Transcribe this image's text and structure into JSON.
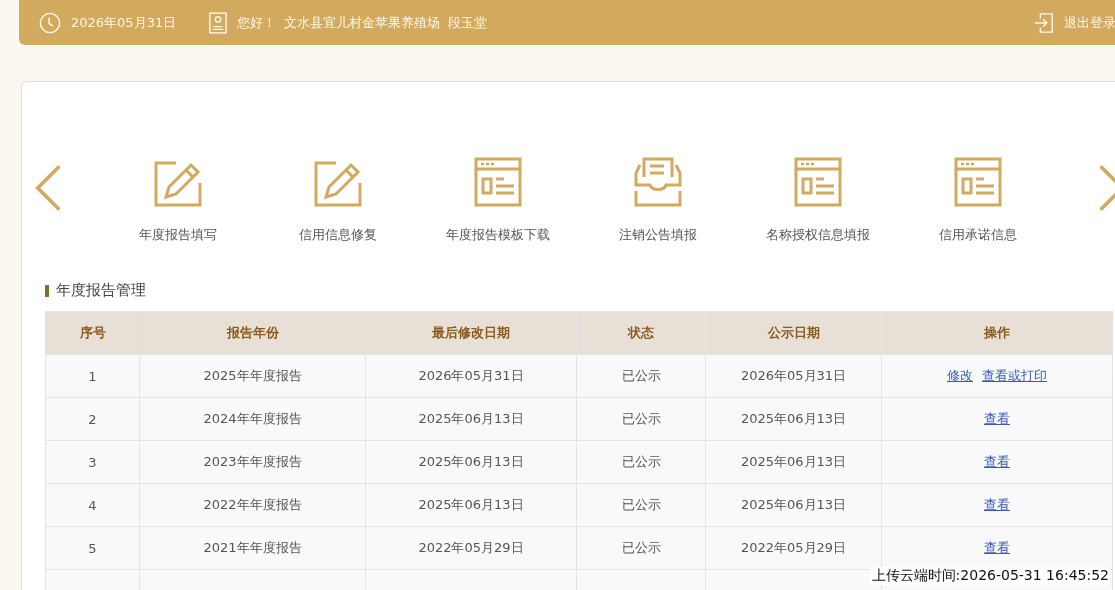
{
  "header": {
    "date": "2026年05月31日",
    "greeting": "您好！",
    "company": "文水县宜儿村金苹果养殖场",
    "person": "段玉堂",
    "logout": "退出登录"
  },
  "services": [
    {
      "kind": "edit",
      "label": "年度报告填写"
    },
    {
      "kind": "edit",
      "label": "信用信息修复"
    },
    {
      "kind": "form",
      "label": "年度报告模板下载"
    },
    {
      "kind": "tray",
      "label": "注销公告填报"
    },
    {
      "kind": "form",
      "label": "名称授权信息填报"
    },
    {
      "kind": "form",
      "label": "信用承诺信息"
    }
  ],
  "section_title": "年度报告管理",
  "table": {
    "columns": [
      "序号",
      "报告年份",
      "最后修改日期",
      "状态",
      "公示日期",
      "操作"
    ],
    "rows": [
      {
        "cells": [
          "1",
          "2025年年度报告",
          "2026年05月31日",
          "已公示",
          "2026年05月31日"
        ],
        "actions": [
          "修改",
          "查看或打印"
        ]
      },
      {
        "cells": [
          "2",
          "2024年年度报告",
          "2025年06月13日",
          "已公示",
          "2025年06月13日"
        ],
        "actions": [
          "查看"
        ]
      },
      {
        "cells": [
          "3",
          "2023年年度报告",
          "2025年06月13日",
          "已公示",
          "2025年06月13日"
        ],
        "actions": [
          "查看"
        ]
      },
      {
        "cells": [
          "4",
          "2022年年度报告",
          "2025年06月13日",
          "已公示",
          "2025年06月13日"
        ],
        "actions": [
          "查看"
        ]
      },
      {
        "cells": [
          "5",
          "2021年年度报告",
          "2022年05月29日",
          "已公示",
          "2022年05月29日"
        ],
        "actions": [
          "查看"
        ]
      }
    ]
  },
  "upload_time": "上传云端时间:2026-05-31 16:45:52"
}
